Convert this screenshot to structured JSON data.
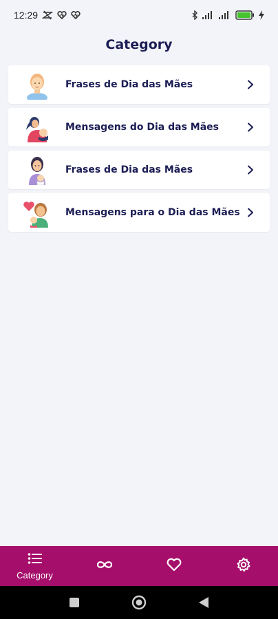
{
  "status_bar": {
    "time": "12:29",
    "battery_color": "#46c42e"
  },
  "header": {
    "title": "Category"
  },
  "categories": [
    {
      "label": "Frases de Dia das Mães",
      "avatar": "mother-face-icon"
    },
    {
      "label": "Mensagens do Dia das Mães",
      "avatar": "mother-holding-baby-icon"
    },
    {
      "label": "Frases de Dia das Mães",
      "avatar": "mother-with-child-icon"
    },
    {
      "label": "Mensagens para o Dia das Mães",
      "avatar": "mother-child-heart-icon"
    }
  ],
  "bottom_nav": {
    "background": "#a50e6b",
    "items": [
      {
        "label": "Category",
        "icon": "list-icon",
        "active": true
      },
      {
        "label": "",
        "icon": "infinity-icon",
        "active": false
      },
      {
        "label": "",
        "icon": "heart-icon",
        "active": false
      },
      {
        "label": "",
        "icon": "gear-icon",
        "active": false
      }
    ]
  }
}
